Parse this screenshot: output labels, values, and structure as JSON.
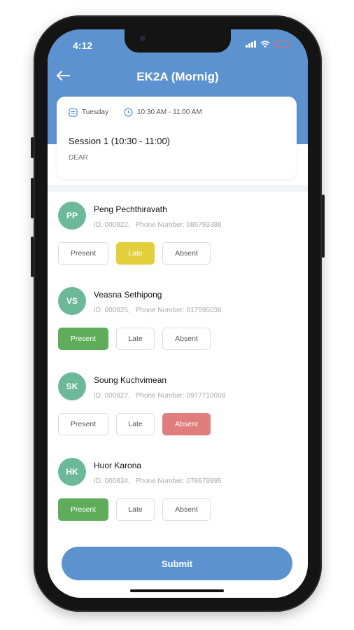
{
  "status_bar": {
    "time": "4:12"
  },
  "header": {
    "title": "EK2A (Mornig)"
  },
  "session_card": {
    "day": "Tuesday",
    "time_range": "10:30 AM - 11:00 AM",
    "session": "Session 1 (10:30 - 11:00)",
    "subject": "DEAR"
  },
  "options": {
    "present": "Present",
    "late": "Late",
    "absent": "Absent"
  },
  "students": [
    {
      "initials": "PP",
      "name": "Peng Pechthiravath",
      "id": "ID: 000822,",
      "phone": "Phone Number: 086793388",
      "status": "late"
    },
    {
      "initials": "VS",
      "name": "Veasna Sethipong",
      "id": "ID: 000825,",
      "phone": "Phone Number: 017595036",
      "status": "present"
    },
    {
      "initials": "SK",
      "name": "Soung Kuchvimean",
      "id": "ID: 000827,",
      "phone": "Phone Number: 0977710008",
      "status": "absent"
    },
    {
      "initials": "HK",
      "name": "Huor Karona",
      "id": "ID: 000834,",
      "phone": "Phone Number: 076679995",
      "status": "present"
    }
  ],
  "submit_label": "Submit",
  "colors": {
    "primary": "#5b92cf",
    "present": "#5fad5a",
    "late": "#e3cf3c",
    "absent": "#e07d7d",
    "avatar": "#6cb99a"
  }
}
